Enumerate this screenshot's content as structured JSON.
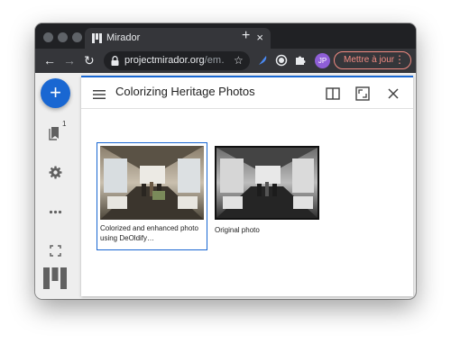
{
  "browser": {
    "tab_title": "Mirador",
    "tab_close": "×",
    "new_tab": "+",
    "nav_back": "←",
    "nav_forward": "→",
    "nav_reload": "↻",
    "url_domain": "projectmirador.org",
    "url_path": "/em…",
    "star": "☆",
    "profile_initials": "JP",
    "update_label": "Mettre à jour",
    "update_menu": "⋮"
  },
  "sidebar": {
    "add_label": "+",
    "windows_badge": "1"
  },
  "window": {
    "title": "Colorizing Heritage Photos"
  },
  "gallery": [
    {
      "caption": "Colorized and enhanced photo using DeOldify…",
      "selected": true,
      "tone": "color"
    },
    {
      "caption": "Original photo",
      "selected": false,
      "tone": "grayscale"
    }
  ],
  "colors": {
    "accent": "#1967d2",
    "update": "#f28b82",
    "profile": "#8e5ed6"
  }
}
